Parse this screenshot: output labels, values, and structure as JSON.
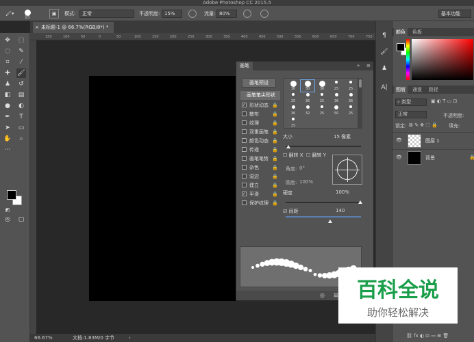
{
  "app": {
    "title": "Adobe Photoshop CC 2015.5"
  },
  "options_bar": {
    "brush_size": "15",
    "mode_label": "模式:",
    "mode_value": "正常",
    "opacity_label": "不透明度:",
    "opacity_value": "15%",
    "flow_label": "流量:",
    "flow_value": "80%",
    "workspace": "基本功能"
  },
  "document": {
    "tab_label": "未标题-1 @ 66.7%(RGB/8*) *",
    "zoom": "66.67%",
    "doc_info": "文档:1.83M/0 字节",
    "ruler_ticks": [
      "150",
      "100",
      "50",
      "0",
      "50",
      "100",
      "150",
      "200",
      "250",
      "300",
      "350",
      "400",
      "450",
      "500",
      "550",
      "600",
      "650",
      "700",
      "750"
    ]
  },
  "brush_panel": {
    "tab_label": "画笔",
    "preset_button": "画笔预设",
    "shape_header": "画笔笔尖形状",
    "options": [
      {
        "label": "形状动态",
        "checked": true
      },
      {
        "label": "散布",
        "checked": false
      },
      {
        "label": "纹理",
        "checked": false
      },
      {
        "label": "双重画笔",
        "checked": false
      },
      {
        "label": "颜色动态",
        "checked": false
      },
      {
        "label": "传递",
        "checked": false
      },
      {
        "label": "画笔笔势",
        "checked": false
      },
      {
        "label": "杂色",
        "checked": false
      },
      {
        "label": "湿边",
        "checked": false
      },
      {
        "label": "建立",
        "checked": false
      },
      {
        "label": "平滑",
        "checked": true
      },
      {
        "label": "保护纹理",
        "checked": false
      }
    ],
    "tip_numbers": [
      "30",
      "30",
      "30",
      "25",
      "25",
      "25",
      "36",
      "25",
      "36",
      "36",
      "36",
      "32",
      "25",
      "50",
      "25",
      "25"
    ],
    "size_label": "大小",
    "size_value": "15 像素",
    "flip_x": "翻转 X",
    "flip_y": "翻转 Y",
    "angle_label": "角度:",
    "angle_value": "0°",
    "roundness_label": "圆度:",
    "roundness_value": "100%",
    "hardness_label": "硬度",
    "hardness_value": "100%",
    "spacing_label": "间距",
    "spacing_value": "140"
  },
  "right_panels": {
    "color_tabs": [
      "颜色",
      "色板"
    ],
    "layer_tabs": [
      "图层",
      "通道",
      "路径"
    ],
    "kind_filter": "类型",
    "blend_mode": "正常",
    "opacity_label": "不透明度:",
    "lock_label": "锁定:",
    "fill_label": "填充:",
    "layers": [
      {
        "name": "图层 1",
        "thumb": "transparent"
      },
      {
        "name": "背景",
        "thumb": "#000000"
      }
    ]
  },
  "watermark": {
    "title": "百科全说",
    "subtitle": "助你轻松解决"
  }
}
